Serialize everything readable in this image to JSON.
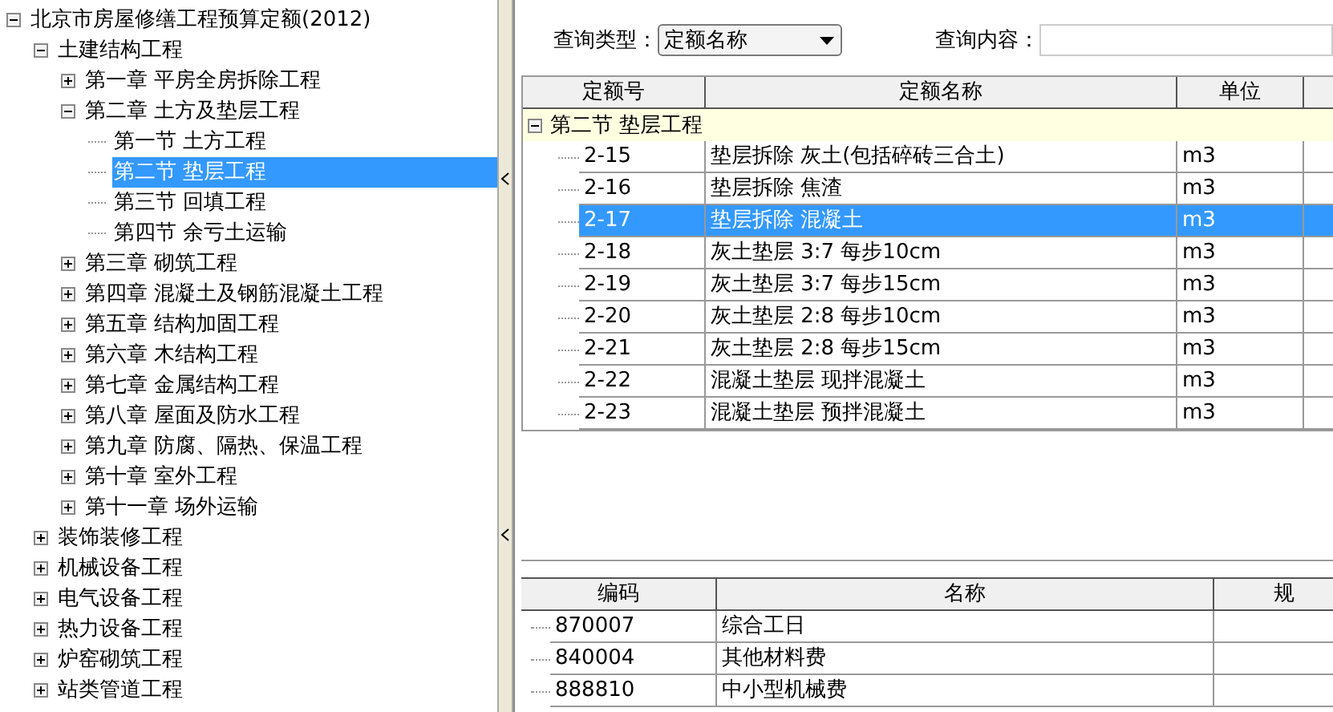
{
  "tree": [
    {
      "label": "北京市房屋修缮工程预算定额(2012)",
      "expanded": true,
      "selected": false,
      "children": [
        {
          "label": "土建结构工程",
          "expanded": true,
          "selected": false,
          "children": [
            {
              "label": "第一章  平房全房拆除工程",
              "expanded": false,
              "selected": false
            },
            {
              "label": "第二章  土方及垫层工程",
              "expanded": true,
              "selected": false,
              "children": [
                {
                  "label": "第一节  土方工程",
                  "selected": false
                },
                {
                  "label": "第二节  垫层工程",
                  "selected": true
                },
                {
                  "label": "第三节  回填工程",
                  "selected": false
                },
                {
                  "label": "第四节  余亏土运输",
                  "selected": false
                }
              ]
            },
            {
              "label": "第三章  砌筑工程",
              "expanded": false,
              "selected": false
            },
            {
              "label": "第四章  混凝土及钢筋混凝土工程",
              "expanded": false,
              "selected": false
            },
            {
              "label": "第五章  结构加固工程",
              "expanded": false,
              "selected": false
            },
            {
              "label": "第六章  木结构工程",
              "expanded": false,
              "selected": false
            },
            {
              "label": "第七章  金属结构工程",
              "expanded": false,
              "selected": false
            },
            {
              "label": "第八章  屋面及防水工程",
              "expanded": false,
              "selected": false
            },
            {
              "label": "第九章  防腐、隔热、保温工程",
              "expanded": false,
              "selected": false
            },
            {
              "label": "第十章  室外工程",
              "expanded": false,
              "selected": false
            },
            {
              "label": "第十一章  场外运输",
              "expanded": false,
              "selected": false
            }
          ]
        },
        {
          "label": "装饰装修工程",
          "expanded": false,
          "selected": false
        },
        {
          "label": "机械设备工程",
          "expanded": false,
          "selected": false
        },
        {
          "label": "电气设备工程",
          "expanded": false,
          "selected": false
        },
        {
          "label": "热力设备工程",
          "expanded": false,
          "selected": false
        },
        {
          "label": "炉窑砌筑工程",
          "expanded": false,
          "selected": false
        },
        {
          "label": "站类管道工程",
          "expanded": false,
          "selected": false
        }
      ]
    }
  ],
  "query": {
    "type_label": "查询类型：",
    "type_value": "定额名称",
    "content_label": "查询内容："
  },
  "quota_table": {
    "columns": [
      "定额号",
      "定额名称",
      "单位"
    ],
    "group": {
      "label": "第二节  垫层工程",
      "expanded": true
    },
    "rows": [
      {
        "code": "2-15",
        "name": "垫层拆除  灰土(包括碎砖三合土)",
        "unit": "m3",
        "selected": false
      },
      {
        "code": "2-16",
        "name": "垫层拆除  焦渣",
        "unit": "m3",
        "selected": false
      },
      {
        "code": "2-17",
        "name": "垫层拆除  混凝土",
        "unit": "m3",
        "selected": true
      },
      {
        "code": "2-18",
        "name": "灰土垫层  3:7  每步10cm",
        "unit": "m3",
        "selected": false
      },
      {
        "code": "2-19",
        "name": "灰土垫层  3:7  每步15cm",
        "unit": "m3",
        "selected": false
      },
      {
        "code": "2-20",
        "name": "灰土垫层  2:8  每步10cm",
        "unit": "m3",
        "selected": false
      },
      {
        "code": "2-21",
        "name": "灰土垫层  2:8  每步15cm",
        "unit": "m3",
        "selected": false
      },
      {
        "code": "2-22",
        "name": "混凝土垫层  现拌混凝土",
        "unit": "m3",
        "selected": false
      },
      {
        "code": "2-23",
        "name": "混凝土垫层  预拌混凝土",
        "unit": "m3",
        "selected": false
      }
    ]
  },
  "resource_table": {
    "columns": [
      "编码",
      "名称",
      "规"
    ],
    "rows": [
      {
        "code": "870007",
        "name": "综合工日"
      },
      {
        "code": "840004",
        "name": "其他材料费"
      },
      {
        "code": "888810",
        "name": "中小型机械费"
      }
    ]
  }
}
